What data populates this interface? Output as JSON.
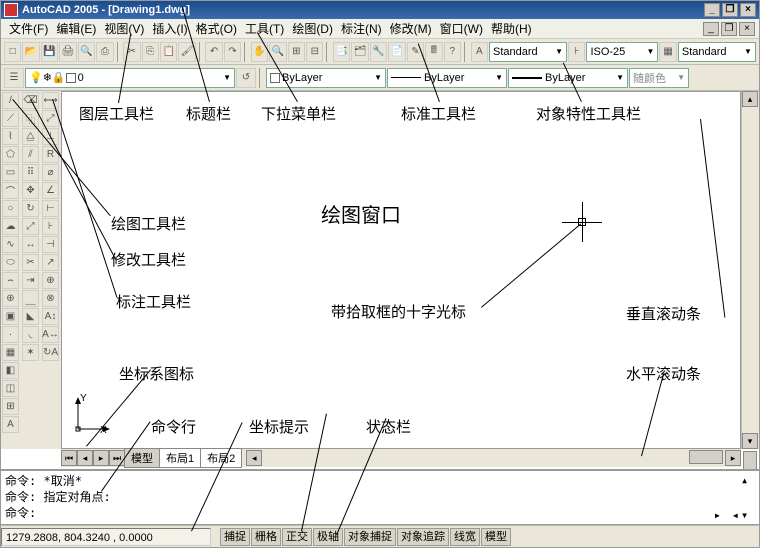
{
  "title": "AutoCAD 2005 - [Drawing1.dwg]",
  "menu": [
    "文件(F)",
    "编辑(E)",
    "视图(V)",
    "插入(I)",
    "格式(O)",
    "工具(T)",
    "绘图(D)",
    "标注(N)",
    "修改(M)",
    "窗口(W)",
    "帮助(H)"
  ],
  "dropdowns": {
    "textstyle": "Standard",
    "dimstyle": "ISO-25",
    "tablestyle": "Standard",
    "layer": "0",
    "color": "ByLayer",
    "ltype": "ByLayer",
    "lweight": "ByLayer",
    "plot": "随颜色"
  },
  "tabs": [
    "模型",
    "布局1",
    "布局2"
  ],
  "cmd": {
    "l1_label": "命令:",
    "l1_text": "*取消*",
    "l2_label": "命令:",
    "l2_text": "指定对角点:",
    "l3_label": "命令:"
  },
  "coord": "1279.2808, 804.3240 , 0.0000",
  "status_buttons": [
    "捕捉",
    "栅格",
    "正交",
    "极轴",
    "对象捕捉",
    "对象追踪",
    "线宽",
    "模型"
  ],
  "ucs": {
    "x": "X",
    "y": "Y"
  },
  "annotations": {
    "layer_toolbar": "图层工具栏",
    "title_bar": "标题栏",
    "menu_bar": "下拉菜单栏",
    "std_toolbar": "标准工具栏",
    "prop_toolbar": "对象特性工具栏",
    "draw_toolbar": "绘图工具栏",
    "modify_toolbar": "修改工具栏",
    "dim_toolbar": "标注工具栏",
    "draw_window": "绘图窗口",
    "crosshair": "带拾取框的十字光标",
    "vscroll": "垂直滚动条",
    "ucs_icon": "坐标系图标",
    "hscroll": "水平滚动条",
    "cmdline": "命令行",
    "coord_display": "坐标提示",
    "statusbar": "状态栏"
  }
}
